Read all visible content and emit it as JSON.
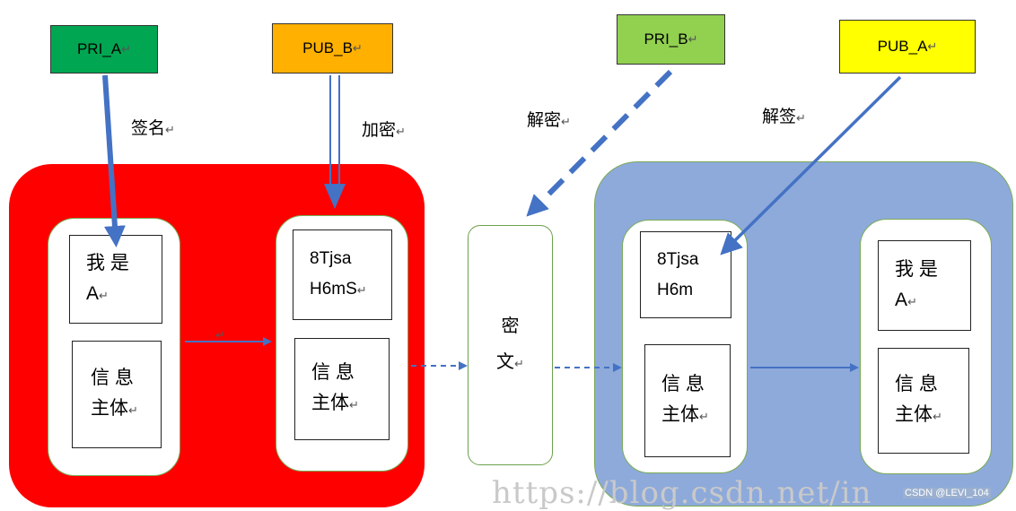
{
  "keys": {
    "pri_a": "PRI_A",
    "pub_b": "PUB_B",
    "pri_b": "PRI_B",
    "pub_a": "PUB_A"
  },
  "return_mark": "↵",
  "labels": {
    "sign": "签名",
    "encrypt": "加密",
    "decrypt": "解密",
    "verify": "解签"
  },
  "sender": {
    "signature_line1": "我 是",
    "signature_line2": "A",
    "body_line1": "信 息",
    "body_line2": "主体"
  },
  "encrypted": {
    "signature_line1": "8Tjsa",
    "signature_line2": "H6mS",
    "body_line1": "信 息",
    "body_line2": "主体"
  },
  "ciphertext": {
    "line1": "密",
    "line2": "文"
  },
  "decrypted": {
    "signature_line1": "8Tjsa",
    "signature_line2": "H6m",
    "body_line1": "信 息",
    "body_line2": "主体"
  },
  "verified": {
    "signature_line1": "我 是",
    "signature_line2": "A",
    "body_line1": "信 息",
    "body_line2": "主体"
  },
  "watermark": "https://blog.csdn.net/in",
  "credit": "CSDN @LEVI_104",
  "colors": {
    "pri_a_key": "#00a651",
    "pub_b_key": "#ffb000",
    "pri_b_key": "#92d050",
    "pub_a_key": "#ffff00",
    "left_panel": "#ff0000",
    "right_panel": "#8eaadb",
    "arrow": "#4472c4"
  }
}
